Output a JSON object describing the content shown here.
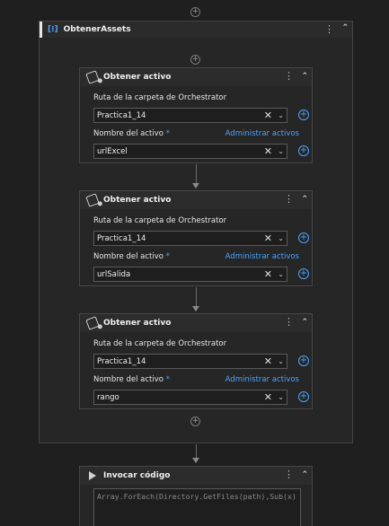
{
  "sequence": {
    "title": "ObtenerAssets"
  },
  "activities": [
    {
      "title": "Obtener activo",
      "folder_label": "Ruta de la carpeta de Orchestrator",
      "folder_value": "Practica1_14",
      "name_label": "Nombre del activo",
      "required_mark": "*",
      "manage_link": "Administrar activos",
      "name_value": "urlExcel"
    },
    {
      "title": "Obtener activo",
      "folder_label": "Ruta de la carpeta de Orchestrator",
      "folder_value": "Practica1_14",
      "name_label": "Nombre del activo",
      "required_mark": "*",
      "manage_link": "Administrar activos",
      "name_value": "urlSalida"
    },
    {
      "title": "Obtener activo",
      "folder_label": "Ruta de la carpeta de Orchestrator",
      "folder_value": "Practica1_14",
      "name_label": "Nombre del activo",
      "required_mark": "*",
      "manage_link": "Administrar activos",
      "name_value": "rango"
    }
  ],
  "invoke": {
    "title": "Invocar código",
    "code": "Array.ForEach(Directory.GetFiles(path),Sub(x) File.Delete"
  },
  "icons": {
    "add": "plus-circle-icon",
    "menu": "kebab-menu-icon",
    "collapse": "double-chevron-up-icon",
    "clear": "clear-x-icon",
    "dropdown": "chevron-down-icon"
  },
  "colors": {
    "background": "#1f1f1f",
    "accent": "#4aa3ff",
    "panel": "#262626"
  }
}
